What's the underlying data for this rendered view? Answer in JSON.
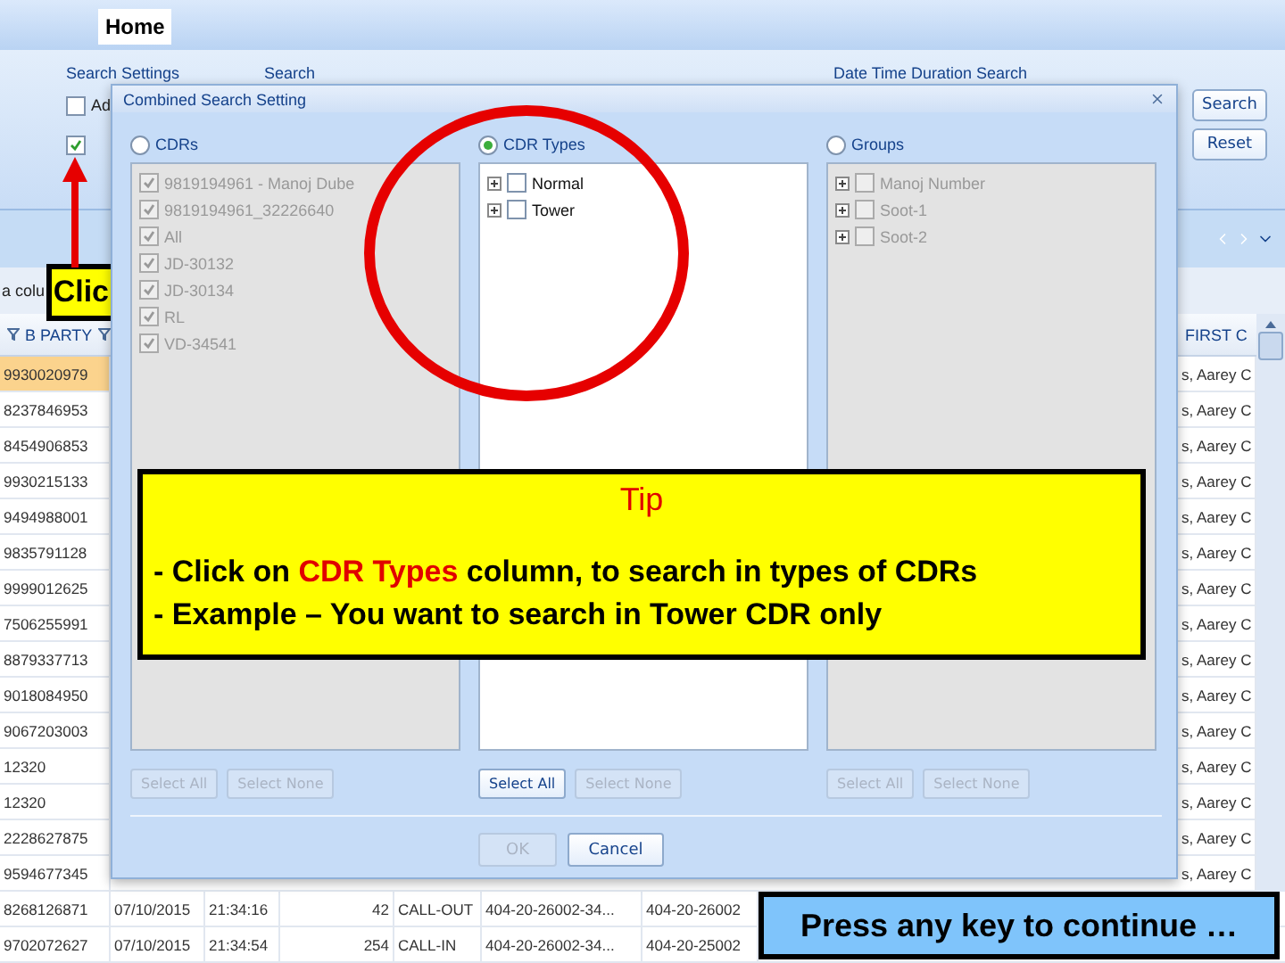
{
  "app": {
    "tab": "Home",
    "ribbon_groups": [
      "Search Settings",
      "Search",
      "Date Time Duration Search"
    ],
    "setting_checkboxes": [
      {
        "label": "Ad",
        "checked": false
      },
      {
        "checked": true
      }
    ],
    "buttons": [
      "Search",
      "Reset"
    ]
  },
  "grid": {
    "group_hint": "a colu",
    "columns": [
      "B PARTY",
      "FIRST C"
    ],
    "rows": [
      {
        "b_party": "9930020979",
        "first_c": "s, Aarey C",
        "selected": true
      },
      {
        "b_party": "8237846953",
        "first_c": "s, Aarey C",
        "selected": false
      },
      {
        "b_party": "8454906853",
        "first_c": "s, Aarey C",
        "selected": false
      },
      {
        "b_party": "9930215133",
        "first_c": "s, Aarey C",
        "selected": false
      },
      {
        "b_party": "9494988001",
        "first_c": "s, Aarey C",
        "selected": false
      },
      {
        "b_party": "9835791128",
        "first_c": "s, Aarey C",
        "selected": false
      },
      {
        "b_party": "9999012625",
        "first_c": "s, Aarey C",
        "selected": false
      },
      {
        "b_party": "7506255991",
        "first_c": "s, Aarey C",
        "selected": false
      },
      {
        "b_party": "8879337713",
        "first_c": "s, Aarey C",
        "selected": false
      },
      {
        "b_party": "9018084950",
        "first_c": "s, Aarey C",
        "selected": false
      },
      {
        "b_party": "9067203003",
        "first_c": "s, Aarey C",
        "selected": false
      },
      {
        "b_party": "12320",
        "first_c": "s, Aarey C",
        "selected": false
      },
      {
        "b_party": "12320",
        "first_c": "s, Aarey C",
        "selected": false
      },
      {
        "b_party": "2228627875",
        "first_c": "s, Aarey C",
        "selected": false
      },
      {
        "b_party": "9594677345",
        "first_c": "s, Aarey C",
        "selected": false
      }
    ],
    "full_rows": [
      [
        "8268126871",
        "07/10/2015",
        "21:34:16",
        "42",
        "CALL-OUT",
        "404-20-26002-34...",
        "404-20-26002"
      ],
      [
        "9702072627",
        "07/10/2015",
        "21:34:54",
        "254",
        "CALL-IN",
        "404-20-26002-34...",
        "404-20-25002"
      ]
    ]
  },
  "dialog": {
    "title": "Combined Search Setting",
    "columns": [
      {
        "label": "CDRs",
        "selected": false,
        "disabled": true,
        "kind": "list",
        "items": [
          {
            "label": "9819194961 - Manoj Dube",
            "checked": true
          },
          {
            "label": "9819194961_32226640",
            "checked": true
          },
          {
            "label": "All",
            "checked": true
          },
          {
            "label": "JD-30132",
            "checked": true
          },
          {
            "label": "JD-30134",
            "checked": true
          },
          {
            "label": "RL",
            "checked": true
          },
          {
            "label": "VD-34541",
            "checked": true
          }
        ],
        "buttons": [
          {
            "label": "Select All",
            "disabled": true
          },
          {
            "label": "Select None",
            "disabled": true
          }
        ]
      },
      {
        "label": "CDR Types",
        "selected": true,
        "disabled": false,
        "kind": "tree",
        "items": [
          {
            "label": "Normal",
            "checked": false
          },
          {
            "label": "Tower",
            "checked": false
          }
        ],
        "buttons": [
          {
            "label": "Select All",
            "disabled": false
          },
          {
            "label": "Select None",
            "disabled": true
          }
        ]
      },
      {
        "label": "Groups",
        "selected": false,
        "disabled": true,
        "kind": "tree",
        "items": [
          {
            "label": "Manoj Number",
            "checked": false
          },
          {
            "label": "Soot-1",
            "checked": false
          },
          {
            "label": "Soot-2",
            "checked": false
          }
        ],
        "buttons": [
          {
            "label": "Select All",
            "disabled": true
          },
          {
            "label": "Select None",
            "disabled": true
          }
        ]
      }
    ],
    "footer_buttons": [
      {
        "label": "OK",
        "disabled": true
      },
      {
        "label": "Cancel",
        "disabled": false
      }
    ]
  },
  "annotations": {
    "click_callout": "Clic",
    "tip": {
      "title": "Tip",
      "lines": [
        [
          {
            "text": "- Click on ",
            "highlight": false
          },
          {
            "text": "CDR Types",
            "highlight": true
          },
          {
            "text": " column, to search in types of CDRs",
            "highlight": false
          }
        ],
        [
          {
            "text": "- Example – You want to search in Tower CDR only",
            "highlight": false
          }
        ]
      ]
    },
    "continue_prompt": "Press any key to continue …"
  }
}
